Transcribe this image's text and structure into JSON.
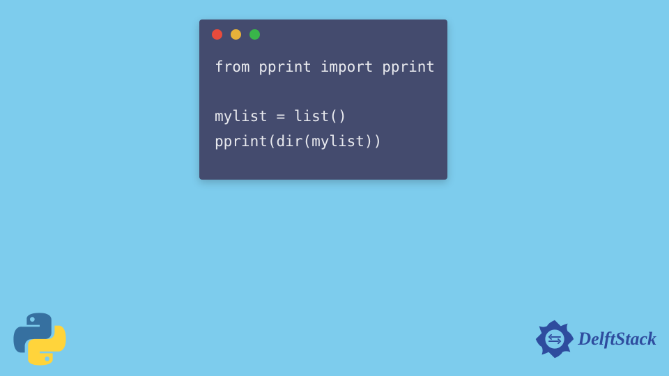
{
  "code": {
    "line1": "from pprint import pprint",
    "line2": "",
    "line3": "mylist = list()",
    "line4": "pprint(dir(mylist))"
  },
  "branding": {
    "delft_text": "DelftStack"
  }
}
